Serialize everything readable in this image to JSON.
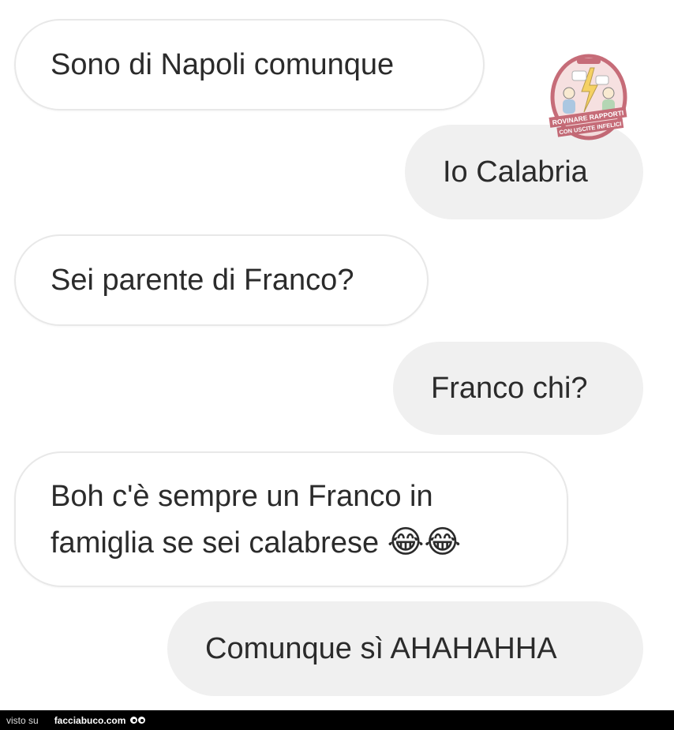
{
  "messages": [
    {
      "id": "b1",
      "direction": "incoming",
      "text": "Sono di Napoli comunque"
    },
    {
      "id": "b2",
      "direction": "outgoing",
      "text": "Io Calabria"
    },
    {
      "id": "b3",
      "direction": "incoming",
      "text": "Sei parente di Franco?"
    },
    {
      "id": "b4",
      "direction": "outgoing",
      "text": "Franco chi?"
    },
    {
      "id": "b5",
      "direction": "incoming",
      "line1": "Boh c'è sempre un Franco in",
      "line2": "famiglia se sei calabrese",
      "emojis": "😂😂"
    },
    {
      "id": "b6",
      "direction": "outgoing",
      "text": "Comunque sì AHAHAHHA"
    }
  ],
  "watermark": {
    "line1": "ROVINARE RAPPORTI",
    "line2": "CON USCITE INFELICI",
    "icon": "bolt-couple-logo-icon",
    "color": "#c0485a"
  },
  "footer": {
    "visto": "visto su",
    "site": "facciabuco.com",
    "icon": "eyes-icon"
  }
}
